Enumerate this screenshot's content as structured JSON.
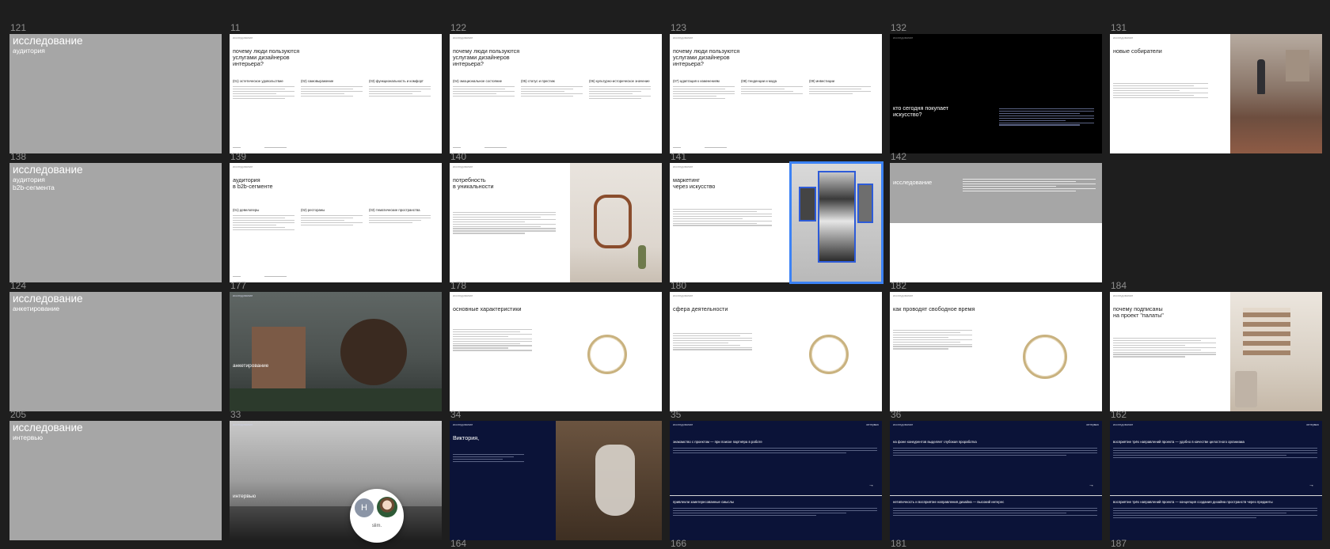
{
  "presence": {
    "initial": "Н",
    "label": "slim."
  },
  "colors": {
    "canvas": "#1e1e1e",
    "selection": "#3b82f6",
    "navy": "#0b1338"
  },
  "slides": [
    {
      "num": "121",
      "title": "исследование",
      "subtitle": "аудитория"
    },
    {
      "num": "11",
      "head": "исследование",
      "title": "почему люди пользуются\nуслугами дизайнеров\nинтерьера?",
      "cols": [
        "(01) эстетическое удовольствие",
        "(02) самовыражение",
        "(03) функциональность и комфорт"
      ]
    },
    {
      "num": "122",
      "head": "исследование",
      "title": "почему люди пользуются\nуслугами дизайнеров\nинтерьера?",
      "cols": [
        "(04) эмоциональное состояние",
        "(05) статус и престиж",
        "(06) культурно-историческое значение"
      ]
    },
    {
      "num": "123",
      "head": "исследование",
      "title": "почему люди пользуются\nуслугами дизайнеров\nинтерьера?",
      "cols": [
        "(07) адаптация к изменениям",
        "(08) тенденции и мода",
        "(09) инвестиции"
      ]
    },
    {
      "num": "132",
      "head": "исследование",
      "title": "кто сегодня покупает\nискусство?"
    },
    {
      "num": "131",
      "head": "исследование",
      "title": "новые собиратели"
    },
    {
      "num": "138",
      "title": "исследование",
      "subtitle": "аудитория\nb2b-сегмента"
    },
    {
      "num": "139",
      "head": "исследование",
      "title": "аудитория\nв b2b-сегменте",
      "cols": [
        "(01) девелоперы",
        "(02) рестораны",
        "(03) тематические пространства"
      ]
    },
    {
      "num": "140",
      "head": "исследование",
      "title": "потребность\nв уникальности"
    },
    {
      "num": "141",
      "head": "исследование",
      "title": "маркетинг\nчерез искусство"
    },
    {
      "num": "142",
      "title": "исследование"
    },
    {
      "num": "124",
      "title": "исследование",
      "subtitle": "анкетирование"
    },
    {
      "num": "177",
      "head": "исследование",
      "title": "анкетирование"
    },
    {
      "num": "178",
      "head": "исследование",
      "title": "основные характеристики"
    },
    {
      "num": "180",
      "head": "исследование",
      "title": "сфера деятельности"
    },
    {
      "num": "182",
      "head": "исследование",
      "title": "как проводят свободное время"
    },
    {
      "num": "184",
      "head": "исследование",
      "title": "почему подписаны\nна проект \"палаты\""
    },
    {
      "num": "205",
      "title": "исследование",
      "subtitle": "интервью"
    },
    {
      "num": "33",
      "head": "исследование",
      "title": "интервью"
    },
    {
      "num": "34",
      "head": "исследование",
      "title": "Виктория,"
    },
    {
      "num": "35",
      "head": "исследование",
      "head_r": "интервью",
      "title": "знакомство с проектом — при поиске партнёра в работе"
    },
    {
      "num": "36",
      "head": "исследование",
      "head_r": "интервью",
      "title": "на фоне конкурентов выделяет глубокая проработка"
    },
    {
      "num": "162",
      "head": "исследование",
      "head_r": "интервью",
      "title": "восприятие трёх направлений проекта — удобно в качестве целостного организма"
    }
  ],
  "extra_titles": {
    "s35b": "привлекли заинтересованные смыслы",
    "s36b": "нетипичность и восприятие направления дизайна — высокий интерес",
    "s162b": "восприятие трёх направлений проекта — концепция создания дизайна пространств через предметы"
  },
  "bottom_nums": [
    "164",
    "166",
    "181",
    "187"
  ]
}
